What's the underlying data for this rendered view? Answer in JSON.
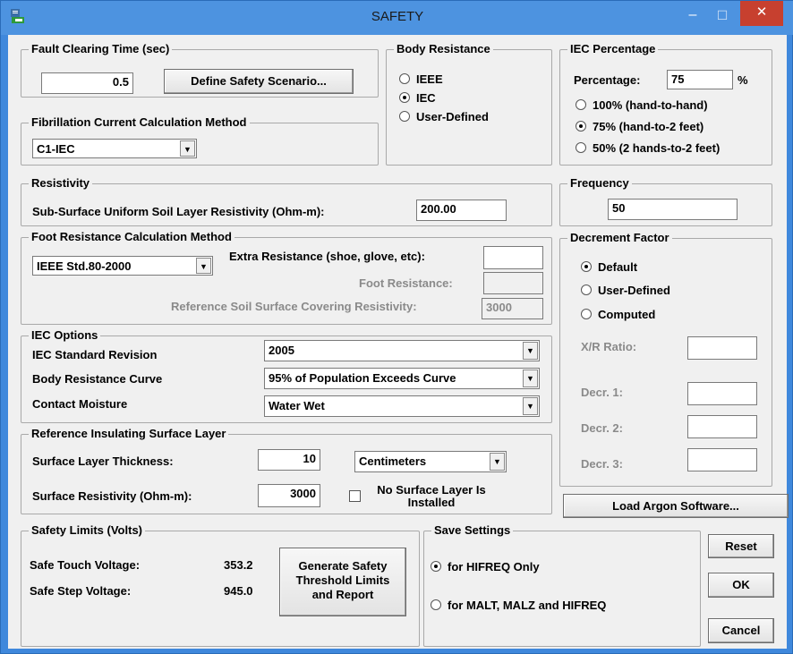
{
  "window": {
    "title": "SAFETY",
    "minimize": "–",
    "maximize": "☐",
    "close": "✕"
  },
  "fault": {
    "group": "Fault Clearing Time (sec)",
    "value": "0.5",
    "define_btn": "Define Safety Scenario..."
  },
  "fibrillation": {
    "group": "Fibrillation Current Calculation Method",
    "selected": "C1-IEC"
  },
  "body_resistance": {
    "group": "Body Resistance",
    "options": [
      "IEEE",
      "IEC",
      "User-Defined"
    ],
    "selected": "IEC"
  },
  "iec_percentage": {
    "group": "IEC Percentage",
    "label": "Percentage:",
    "value": "75",
    "unit": "%",
    "options": [
      "100% (hand-to-hand)",
      "75% (hand-to-2 feet)",
      "50% (2 hands-to-2 feet)"
    ],
    "selected": "75% (hand-to-2 feet)"
  },
  "resistivity": {
    "group": "Resistivity",
    "label": "Sub-Surface Uniform Soil Layer Resistivity (Ohm-m):",
    "value": "200.00"
  },
  "frequency": {
    "group": "Frequency",
    "value": "50"
  },
  "foot": {
    "group": "Foot Resistance Calculation Method",
    "selected": "IEEE Std.80-2000",
    "extra_label": "Extra Resistance (shoe, glove, etc):",
    "extra_value": "",
    "foot_label": "Foot Resistance:",
    "foot_value": "",
    "ref_label": "Reference Soil Surface Covering Resistivity:",
    "ref_value": "3000"
  },
  "decrement": {
    "group": "Decrement Factor",
    "options": [
      "Default",
      "User-Defined",
      "Computed"
    ],
    "selected": "Default",
    "xr_label": "X/R Ratio:",
    "xr_value": "",
    "d1_label": "Decr. 1:",
    "d1_value": "",
    "d2_label": "Decr. 2:",
    "d2_value": "",
    "d3_label": "Decr. 3:",
    "d3_value": ""
  },
  "iec_options": {
    "group": "IEC Options",
    "std_label": "IEC Standard Revision",
    "std_value": "2005",
    "curve_label": "Body Resistance Curve",
    "curve_value": "95% of Population Exceeds Curve",
    "moisture_label": "Contact Moisture",
    "moisture_value": "Water Wet"
  },
  "surface": {
    "group": "Reference Insulating Surface Layer",
    "thick_label": "Surface Layer Thickness:",
    "thick_value": "10",
    "unit_value": "Centimeters",
    "resist_label": "Surface Resistivity (Ohm-m):",
    "resist_value": "3000",
    "no_layer_label": "No Surface Layer Is Installed",
    "no_layer_checked": false
  },
  "load_argon": "Load Argon Software...",
  "safety_limits": {
    "group": "Safety Limits (Volts)",
    "touch_label": "Safe Touch Voltage:",
    "touch_value": "353.2",
    "step_label": "Safe Step Voltage:",
    "step_value": "945.0",
    "generate_btn": "Generate Safety Threshold Limits and Report"
  },
  "save_settings": {
    "group": "Save Settings",
    "options": [
      "for HIFREQ Only",
      "for MALT,  MALZ and HIFREQ"
    ],
    "selected": "for HIFREQ Only"
  },
  "buttons": {
    "reset": "Reset",
    "ok": "OK",
    "cancel": "Cancel"
  }
}
